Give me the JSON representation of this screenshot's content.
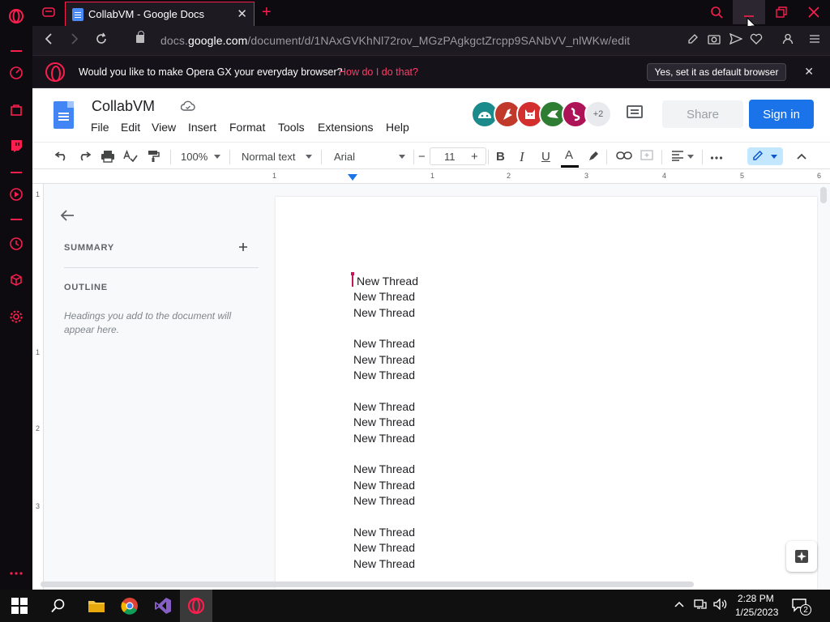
{
  "browser": {
    "tab_title": "CollabVM - Google Docs",
    "tab_close": "✕",
    "new_tab": "+",
    "url_prefix": "docs.",
    "url_domain": "google.com",
    "url_path": "/document/d/1NAxGVKhNl72rov_MGzPAgkgctZrcpp9SANbVV_nlWKw/edit",
    "banner_text": "Would you like to make Opera GX your everyday browser?",
    "banner_link": "How do I do that?",
    "banner_button": "Yes, set it as default browser",
    "banner_close": "✕",
    "accent": "#fa1e4e"
  },
  "docs": {
    "title": "CollabVM",
    "menu": [
      "File",
      "Edit",
      "View",
      "Insert",
      "Format",
      "Tools",
      "Extensions",
      "Help"
    ],
    "avatar_more": "+2",
    "share_label": "Share",
    "signin_label": "Sign in",
    "toolbar": {
      "zoom": "100%",
      "style": "Normal text",
      "font": "Arial",
      "font_size": "11",
      "minus": "−",
      "plus": "+",
      "bold": "B",
      "italic": "I",
      "underline": "U",
      "text_color": "A"
    },
    "ruler_numbers": [
      "1",
      "1",
      "2",
      "3",
      "4",
      "5",
      "6"
    ],
    "vruler_numbers": [
      "1",
      "1",
      "2",
      "3"
    ],
    "outline": {
      "summary": "SUMMARY",
      "outline": "OUTLINE",
      "hint": "Headings you add to the document will appear here."
    },
    "body_lines": [
      "New Thread",
      "New Thread",
      "New Thread",
      "New Thread",
      "New Thread",
      "New Thread",
      "New Thread",
      "New Thread",
      "New Thread",
      "New Thread",
      "New Thread",
      "New Thread",
      "New Thread",
      "New Thread",
      "New Thread"
    ]
  },
  "taskbar": {
    "time": "2:28 PM",
    "date": "1/25/2023",
    "notifications": "2"
  }
}
